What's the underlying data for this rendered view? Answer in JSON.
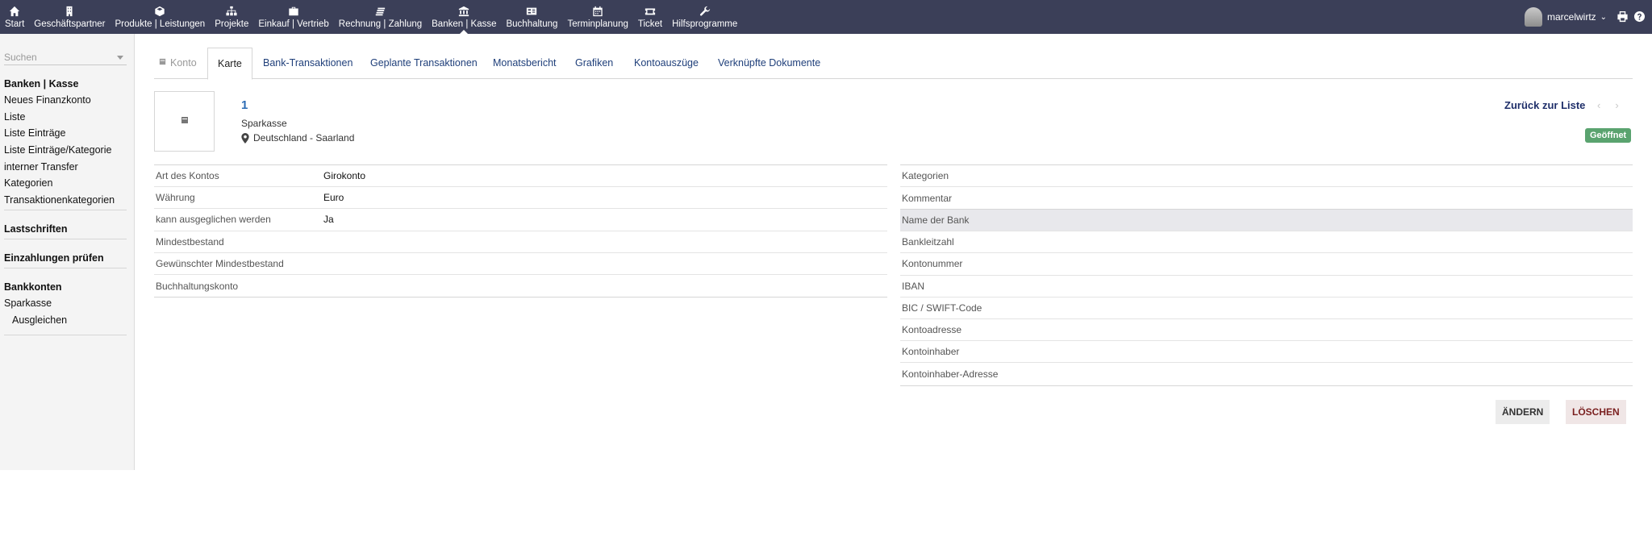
{
  "nav": {
    "items": [
      {
        "label": "Start",
        "icon": "home-icon"
      },
      {
        "label": "Geschäftspartner",
        "icon": "building-icon"
      },
      {
        "label": "Produkte | Leistungen",
        "icon": "cube-icon"
      },
      {
        "label": "Projekte",
        "icon": "sitemap-icon"
      },
      {
        "label": "Einkauf | Vertrieb",
        "icon": "briefcase-icon"
      },
      {
        "label": "Rechnung | Zahlung",
        "icon": "coins-icon"
      },
      {
        "label": "Banken | Kasse",
        "icon": "bank-icon"
      },
      {
        "label": "Buchhaltung",
        "icon": "ledger-icon"
      },
      {
        "label": "Terminplanung",
        "icon": "calendar-icon"
      },
      {
        "label": "Ticket",
        "icon": "ticket-icon"
      },
      {
        "label": "Hilfsprogramme",
        "icon": "wrench-icon"
      }
    ],
    "active": "Banken | Kasse",
    "username": "marcelwirtz"
  },
  "sidebar": {
    "search_placeholder": "Suchen",
    "section1": {
      "title": "Banken | Kasse",
      "links": [
        "Neues Finanzkonto",
        "Liste",
        "Liste Einträge",
        "Liste Einträge/Kategorie",
        "interner Transfer",
        "Kategorien",
        "Transaktionenkategorien"
      ]
    },
    "section2": {
      "title": "Lastschriften"
    },
    "section3": {
      "title": "Einzahlungen prüfen"
    },
    "section4": {
      "title": "Bankkonten",
      "links": [
        "Sparkasse"
      ],
      "sublinks": [
        "Ausgleichen"
      ]
    }
  },
  "tabs": [
    "Konto",
    "Karte",
    "Bank-Transaktionen",
    "Geplante Transaktionen",
    "Monatsbericht",
    "Grafiken",
    "Kontoauszüge",
    "Verknüpfte Dokumente"
  ],
  "active_tab": "Karte",
  "header": {
    "ref": "1",
    "bank": "Sparkasse",
    "location": "Deutschland - Saarland",
    "back_to_list": "Zurück zur Liste",
    "prev": "‹",
    "next": "›",
    "status": "Geöffnet"
  },
  "left_table": [
    {
      "key": "Art des Kontos",
      "value": "Girokonto"
    },
    {
      "key": "Währung",
      "value": "Euro"
    },
    {
      "key": "kann ausgeglichen werden",
      "value": "Ja"
    },
    {
      "key": "Mindestbestand",
      "value": ""
    },
    {
      "key": "Gewünschter Mindestbestand",
      "value": ""
    },
    {
      "key": "Buchhaltungskonto",
      "value": ""
    }
  ],
  "right_table_top": [
    {
      "key": "Kategorien",
      "value": ""
    },
    {
      "key": "Kommentar",
      "value": ""
    }
  ],
  "right_table_bank": [
    {
      "key": "Name der Bank",
      "value": ""
    },
    {
      "key": "Bankleitzahl",
      "value": ""
    },
    {
      "key": "Kontonummer",
      "value": ""
    },
    {
      "key": "IBAN",
      "value": ""
    },
    {
      "key": "BIC / SWIFT-Code",
      "value": ""
    },
    {
      "key": "Kontoadresse",
      "value": ""
    },
    {
      "key": "Kontoinhaber",
      "value": ""
    },
    {
      "key": "Kontoinhaber-Adresse",
      "value": ""
    }
  ],
  "actions": {
    "modify": "ÄNDERN",
    "delete": "LÖSCHEN"
  }
}
